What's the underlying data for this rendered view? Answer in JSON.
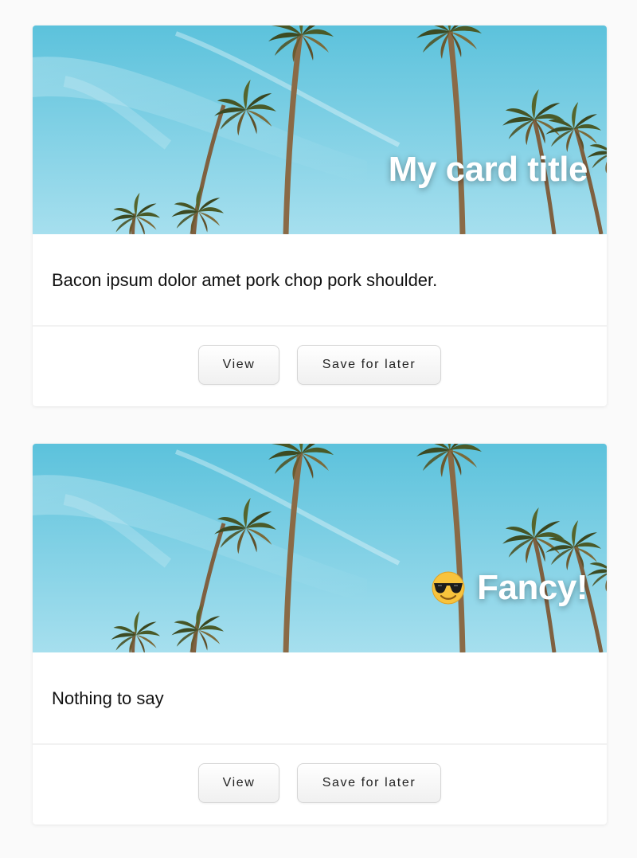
{
  "cards": [
    {
      "title": "My card title",
      "title_icon": "",
      "text": "Bacon ipsum dolor amet pork chop pork shoulder.",
      "actions": {
        "view_label": "View",
        "save_label": "Save for later"
      },
      "image": "palm-trees-against-blue-sky"
    },
    {
      "title": "Fancy!",
      "title_icon": "sunglasses-emoji-icon",
      "text": "Nothing to say",
      "actions": {
        "view_label": "View",
        "save_label": "Save for later"
      },
      "image": "palm-trees-against-blue-sky"
    }
  ],
  "colors": {
    "page_background": "#fafafa",
    "card_background": "#ffffff",
    "sky_top": "#5bc3db",
    "sky_bottom": "#a9e0ee"
  }
}
